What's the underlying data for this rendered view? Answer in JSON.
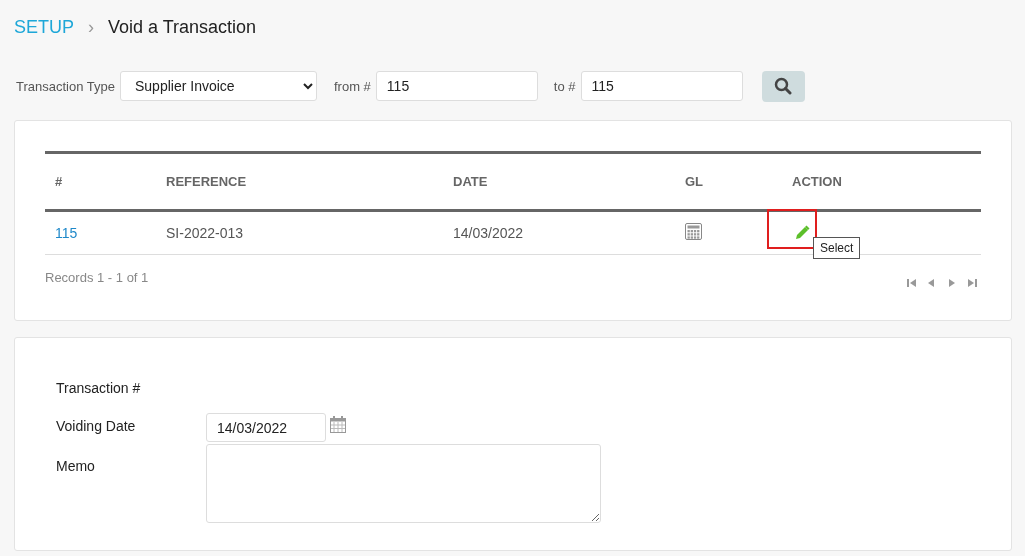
{
  "breadcrumb": {
    "root": "SETUP",
    "separator": "›",
    "title": "Void a Transaction"
  },
  "filter": {
    "type_label": "Transaction Type",
    "type_value": "Supplier Invoice",
    "from_label": "from #",
    "from_value": "115",
    "to_label": "to #",
    "to_value": "115"
  },
  "table": {
    "columns": [
      "#",
      "REFERENCE",
      "DATE",
      "GL",
      "ACTION"
    ],
    "rows": [
      {
        "number": "115",
        "reference": "SI-2022-013",
        "date": "14/03/2022",
        "action_highlighted": true
      }
    ],
    "records": "Records 1 - 1 of 1",
    "tooltip": "Select"
  },
  "form": {
    "transaction_label": "Transaction #",
    "voiding_date_label": "Voiding Date",
    "voiding_date": "14/03/2022",
    "memo_label": "Memo"
  }
}
